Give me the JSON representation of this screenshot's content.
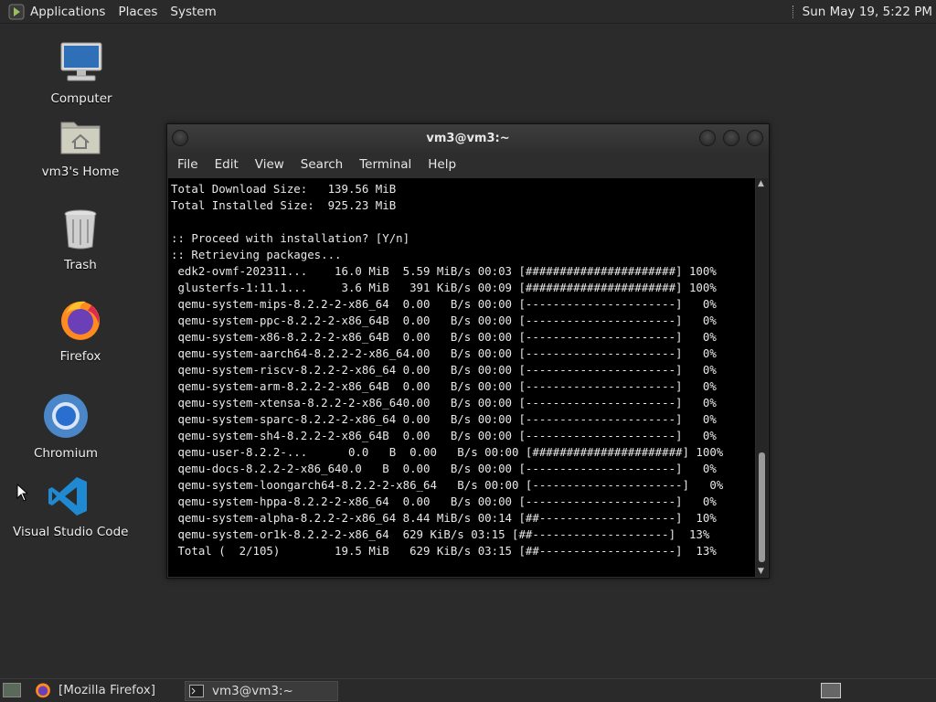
{
  "top_panel": {
    "menus": [
      "Applications",
      "Places",
      "System"
    ],
    "clock": "Sun May 19,  5:22 PM"
  },
  "desktop_icons": [
    {
      "label": "Computer",
      "icon": "computer-icon"
    },
    {
      "label": "vm3's Home",
      "icon": "home-folder-icon"
    },
    {
      "label": "Trash",
      "icon": "trash-icon"
    },
    {
      "label": "Firefox",
      "icon": "firefox-icon"
    },
    {
      "label": "Chromium",
      "icon": "chromium-icon"
    },
    {
      "label": "Visual Studio Code",
      "icon": "vscode-icon"
    }
  ],
  "terminal": {
    "title": "vm3@vm3:~",
    "menu": [
      "File",
      "Edit",
      "View",
      "Search",
      "Terminal",
      "Help"
    ],
    "lines": [
      "Total Download Size:   139.56 MiB",
      "Total Installed Size:  925.23 MiB",
      "",
      ":: Proceed with installation? [Y/n]",
      ":: Retrieving packages...",
      " edk2-ovmf-202311...    16.0 MiB  5.59 MiB/s 00:03 [######################] 100%",
      " glusterfs-1:11.1...     3.6 MiB   391 KiB/s 00:09 [######################] 100%",
      " qemu-system-mips-8.2.2-2-x86_64  0.00   B/s 00:00 [----------------------]   0%",
      " qemu-system-ppc-8.2.2-2-x86_64B  0.00   B/s 00:00 [----------------------]   0%",
      " qemu-system-x86-8.2.2-2-x86_64B  0.00   B/s 00:00 [----------------------]   0%",
      " qemu-system-aarch64-8.2.2-2-x86_64.00   B/s 00:00 [----------------------]   0%",
      " qemu-system-riscv-8.2.2-2-x86_64 0.00   B/s 00:00 [----------------------]   0%",
      " qemu-system-arm-8.2.2-2-x86_64B  0.00   B/s 00:00 [----------------------]   0%",
      " qemu-system-xtensa-8.2.2-2-x86_640.00   B/s 00:00 [----------------------]   0%",
      " qemu-system-sparc-8.2.2-2-x86_64 0.00   B/s 00:00 [----------------------]   0%",
      " qemu-system-sh4-8.2.2-2-x86_64B  0.00   B/s 00:00 [----------------------]   0%",
      " qemu-user-8.2.2-...      0.0   B  0.00   B/s 00:00 [######################] 100%",
      " qemu-docs-8.2.2-2-x86_640.0   B  0.00   B/s 00:00 [----------------------]   0%",
      " qemu-system-loongarch64-8.2.2-2-x86_64   B/s 00:00 [----------------------]   0%",
      " qemu-system-hppa-8.2.2-2-x86_64  0.00   B/s 00:00 [----------------------]   0%",
      " qemu-system-alpha-8.2.2-2-x86_64 8.44 MiB/s 00:14 [##--------------------]  10%",
      " qemu-system-or1k-8.2.2-2-x86_64  629 KiB/s 03:15 [##--------------------]  13%",
      " Total (  2/105)        19.5 MiB   629 KiB/s 03:15 [##--------------------]  13%"
    ]
  },
  "taskbar": {
    "tasks": [
      {
        "label": "[Mozilla Firefox]",
        "icon": "firefox-icon",
        "active": false
      },
      {
        "label": "vm3@vm3:~",
        "icon": "terminal-icon",
        "active": true
      }
    ]
  }
}
